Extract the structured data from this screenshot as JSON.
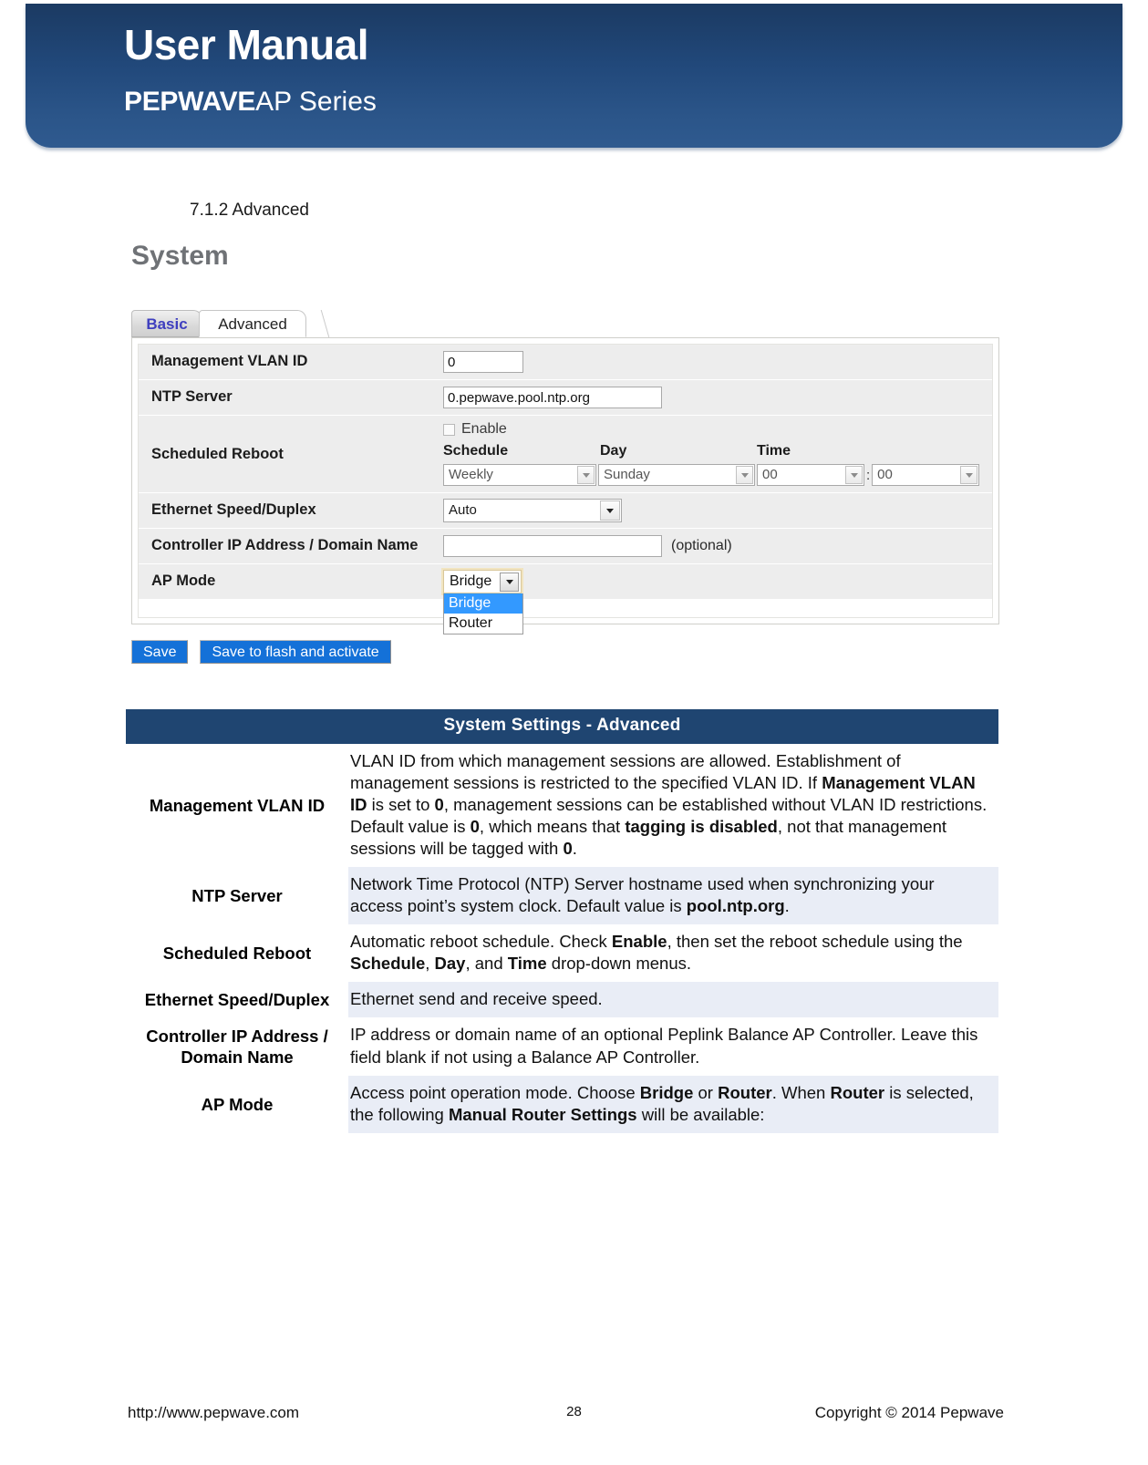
{
  "banner": {
    "title": "User Manual",
    "brand_bold": "PEPWAVE",
    "brand_light": "AP Series",
    "background_color": "#21487a"
  },
  "section": {
    "heading": "7.1.2 Advanced"
  },
  "figure": {
    "title": "System",
    "tabs": [
      {
        "label": "Basic",
        "active": false
      },
      {
        "label": "Advanced",
        "active": true
      }
    ],
    "rows": [
      {
        "label": "Management VLAN ID",
        "control": "textbox",
        "value": "0"
      },
      {
        "label": "NTP Server",
        "control": "textbox",
        "value": "0.pepwave.pool.ntp.org"
      },
      {
        "label": "Scheduled Reboot",
        "control": "schedule",
        "enable_label": "Enable",
        "enable_checked": false,
        "column_headers": [
          "Schedule",
          "Day",
          "Time"
        ],
        "schedule_value": "Weekly",
        "day_value": "Sunday",
        "hour_value": "00",
        "time_separator": ":",
        "minute_value": "00"
      },
      {
        "label": "Ethernet Speed/Duplex",
        "control": "select",
        "value": "Auto"
      },
      {
        "label": "Controller IP Address / Domain Name",
        "control": "textbox",
        "value": "",
        "suffix": "(optional)"
      },
      {
        "label": "AP Mode",
        "control": "open-select",
        "value": "Bridge",
        "options": [
          "Bridge",
          "Router"
        ],
        "selected_option": "Bridge"
      }
    ],
    "buttons": [
      {
        "label": "Save"
      },
      {
        "label": "Save to flash and activate"
      }
    ]
  },
  "desc_table": {
    "header": "System Settings - Advanced",
    "header_color": "#1f4571",
    "shade_color": "#e9edf6",
    "rows": [
      {
        "label": "Management VLAN ID",
        "shaded": false,
        "html": "VLAN ID from which management sessions are allowed. Establishment of management sessions is restricted to the specified VLAN ID. If <b>Management VLAN ID</b> is set to <b>0</b>, management sessions can be established without VLAN ID restrictions. Default value is <b>0</b>, which means that <b>tagging is disabled</b>, not that management sessions will be tagged with <b>0</b>."
      },
      {
        "label": "NTP Server",
        "shaded": true,
        "html": "Network Time Protocol (NTP) Server hostname used when synchronizing your access point’s system clock. Default value is <b>pool.ntp.org</b>."
      },
      {
        "label": "Scheduled Reboot",
        "shaded": false,
        "html": "Automatic reboot schedule. Check <b>Enable</b>, then set the reboot schedule using the <b>Schedule</b>, <b>Day</b>, and <b>Time</b> drop-down menus."
      },
      {
        "label": "Ethernet Speed/Duplex",
        "shaded": true,
        "html": "Ethernet send and receive speed."
      },
      {
        "label": "Controller IP Address / Domain Name",
        "shaded": false,
        "html": "IP address or domain name of an optional Peplink Balance AP Controller. Leave this field blank if not using a Balance AP Controller."
      },
      {
        "label": "AP Mode",
        "shaded": true,
        "html": "Access point operation mode. Choose <b>Bridge</b> or <b>Router</b>. When <b>Router</b> is selected, the following <b>Manual Router Settings</b> will be available:"
      }
    ]
  },
  "footer": {
    "url": "http://www.pepwave.com",
    "page_number": "28",
    "copyright": "Copyright ©  2014  Pepwave"
  }
}
